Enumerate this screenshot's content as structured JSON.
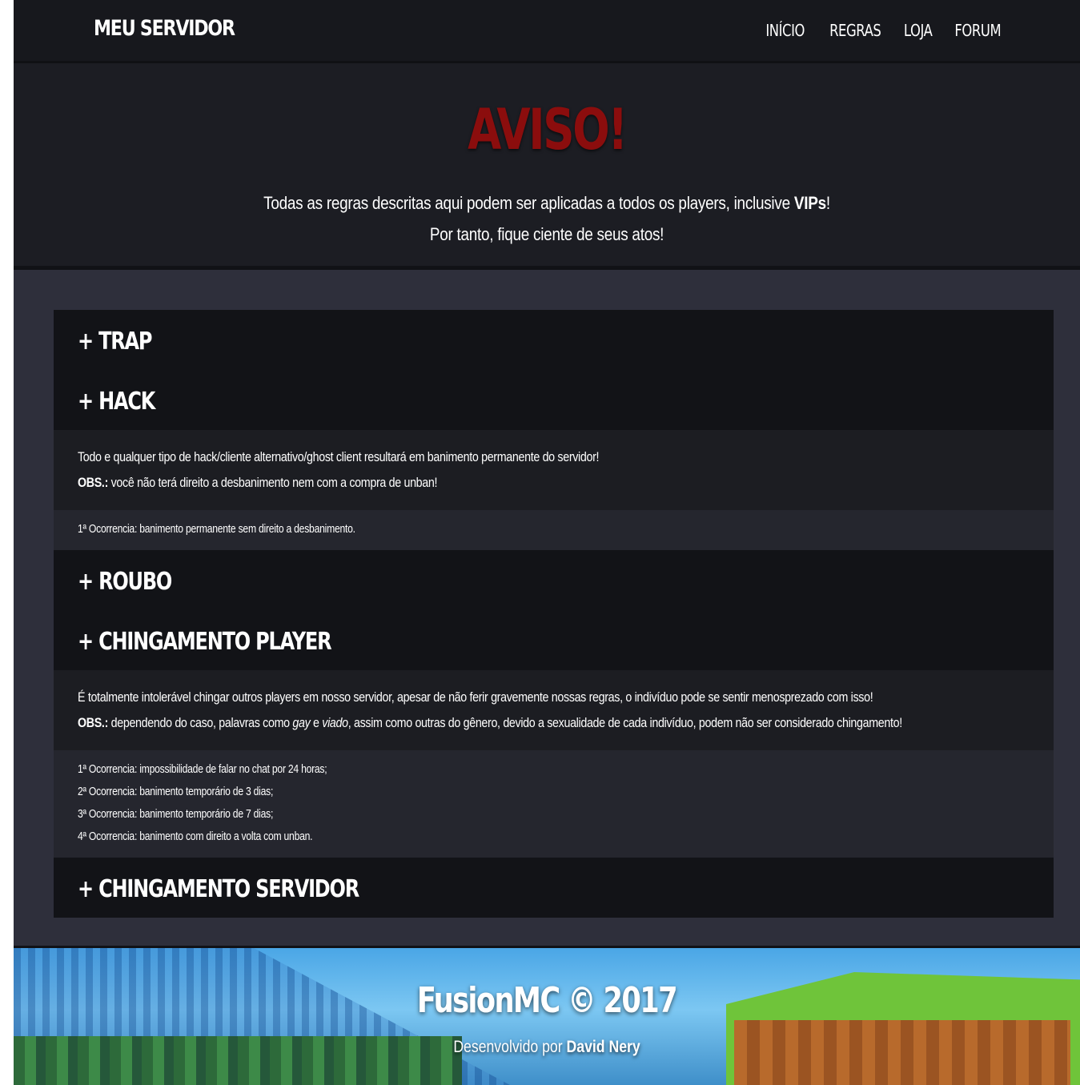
{
  "navbar": {
    "brand": "MEU SERVIDOR",
    "links": [
      "INÍCIO",
      "REGRAS",
      "LOJA",
      "FORUM"
    ]
  },
  "hero": {
    "title": "AVISO!",
    "line1_prefix": "Todas as regras descritas aqui podem ser aplicadas a todos os players, inclusive ",
    "line1_bold": "VIPs",
    "line1_suffix": "!",
    "line2": "Por tanto, fique ciente de seus atos!"
  },
  "rules": {
    "trap": {
      "title": "+ TRAP"
    },
    "hack": {
      "title": "+ HACK",
      "description": "Todo e qualquer tipo de hack/cliente alternativo/ghost client resultará em banimento permanente do servidor!",
      "obs_label": "OBS.:",
      "obs_text": " você não terá direito a desbanimento nem com a compra de unban!",
      "penalties": [
        "1ª Ocorrencia: banimento permanente sem direito a desbanimento."
      ]
    },
    "roubo": {
      "title": "+ ROUBO"
    },
    "chingamento_player": {
      "title": "+ CHINGAMENTO PLAYER",
      "description": "É totalmente intolerável chingar outros players em nosso servidor, apesar de não ferir gravemente nossas regras, o indivíduo pode se sentir menosprezado com isso!",
      "obs_label": "OBS.:",
      "obs_text_1": " dependendo do caso, palavras como ",
      "obs_italic_1": "gay",
      "obs_text_2": " e ",
      "obs_italic_2": "viado",
      "obs_text_3": ", assim como outras do gênero, devido a sexualidade de cada indivíduo, podem não ser considerado chingamento!",
      "penalties": [
        "1ª Ocorrencia: impossibilidade de falar no chat por 24 horas;",
        "2ª Ocorrencia: banimento temporário de 3 dias;",
        "3ª Ocorrencia: banimento temporário de 7 dias;",
        "4ª Ocorrencia: banimento com direito a volta com unban."
      ]
    },
    "chingamento_servidor": {
      "title": "+ CHINGAMENTO SERVIDOR"
    }
  },
  "footer": {
    "title": "FusionMC © 2017",
    "dev_prefix": "Desenvolvido por ",
    "dev_name": "David Nery"
  },
  "colors": {
    "accent_red": "#8b0d0d",
    "navbar_bg": "#17181d",
    "page_bg": "#2e2f3b"
  }
}
